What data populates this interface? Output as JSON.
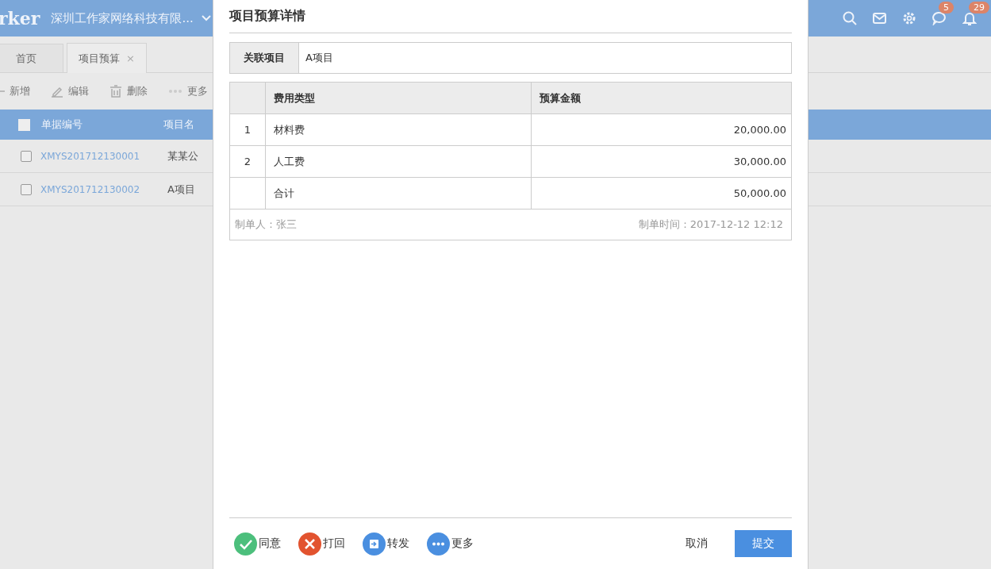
{
  "header": {
    "logo": "rker",
    "company": "深圳工作家网络科技有限...",
    "badges": {
      "chat": "5",
      "notifications": "29"
    }
  },
  "tabs": [
    {
      "label": "首页",
      "selected": false
    },
    {
      "label": "项目预算",
      "selected": true,
      "close": "×"
    }
  ],
  "toolbar": [
    {
      "kind": "add",
      "label": "新增"
    },
    {
      "kind": "edit",
      "label": "编辑"
    },
    {
      "kind": "delete",
      "label": "删除"
    },
    {
      "kind": "more",
      "label": "更多"
    }
  ],
  "list": {
    "columns": [
      "单据编号",
      "项目名"
    ],
    "header_checked": false,
    "rows": [
      {
        "checked": false,
        "number": "XMYS201712130001",
        "project": "某某公"
      },
      {
        "checked": false,
        "number": "XMYS201712130002",
        "project": "A项目"
      }
    ]
  },
  "dialog": {
    "title": "项目预算详情",
    "field": {
      "label": "关联项目",
      "value": "A项目"
    },
    "table": {
      "columns": [
        "费用类型",
        "预算金额"
      ],
      "rows": [
        {
          "index": "1",
          "type": "材料费",
          "amount": "20,000.00"
        },
        {
          "index": "2",
          "type": "人工费",
          "amount": "30,000.00"
        },
        {
          "type": "合计",
          "amount": "50,000.00"
        }
      ]
    },
    "creator": "制单人：张三",
    "created": "制单时间：2017-12-12 12:12",
    "actions": [
      {
        "kind": "approve",
        "label": "同意"
      },
      {
        "kind": "reject",
        "label": "打回"
      },
      {
        "kind": "forward",
        "label": "转发"
      },
      {
        "kind": "more",
        "label": "更多"
      }
    ],
    "cancel": "取消",
    "submit": "提交"
  }
}
